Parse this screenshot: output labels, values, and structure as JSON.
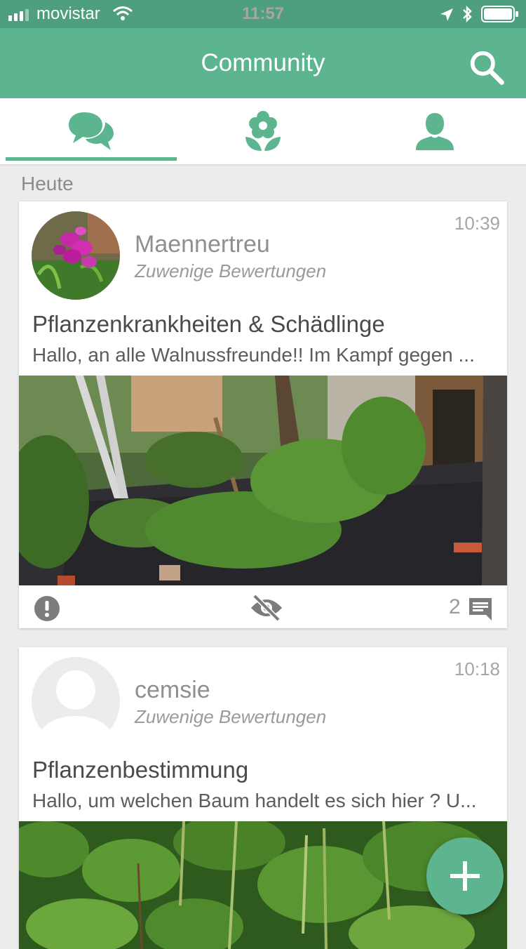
{
  "status_bar": {
    "carrier": "movistar",
    "time": "11:57"
  },
  "app_bar": {
    "title": "Community"
  },
  "tabs": [
    {
      "name": "chat-tab",
      "icon": "chat-bubbles-icon",
      "active": true
    },
    {
      "name": "plants-tab",
      "icon": "flower-icon",
      "active": false
    },
    {
      "name": "profile-tab",
      "icon": "person-icon",
      "active": false
    }
  ],
  "section": {
    "label": "Heute"
  },
  "posts": [
    {
      "author": "Maennertreu",
      "rating": "Zuwenige Bewertungen",
      "time": "10:39",
      "title": "Pflanzenkrankheiten & Schädlinge",
      "excerpt": "Hallo, an alle Walnussfreunde!! Im Kampf gegen ...",
      "comments": "2"
    },
    {
      "author": "cemsie",
      "rating": "Zuwenige Bewertungen",
      "time": "10:18",
      "title": "Pflanzenbestimmung",
      "excerpt": "Hallo, um welchen Baum handelt es sich hier ? U..."
    }
  ],
  "colors": {
    "primary": "#5db590",
    "status_bar": "#4e9f7f",
    "background": "#ececec"
  }
}
